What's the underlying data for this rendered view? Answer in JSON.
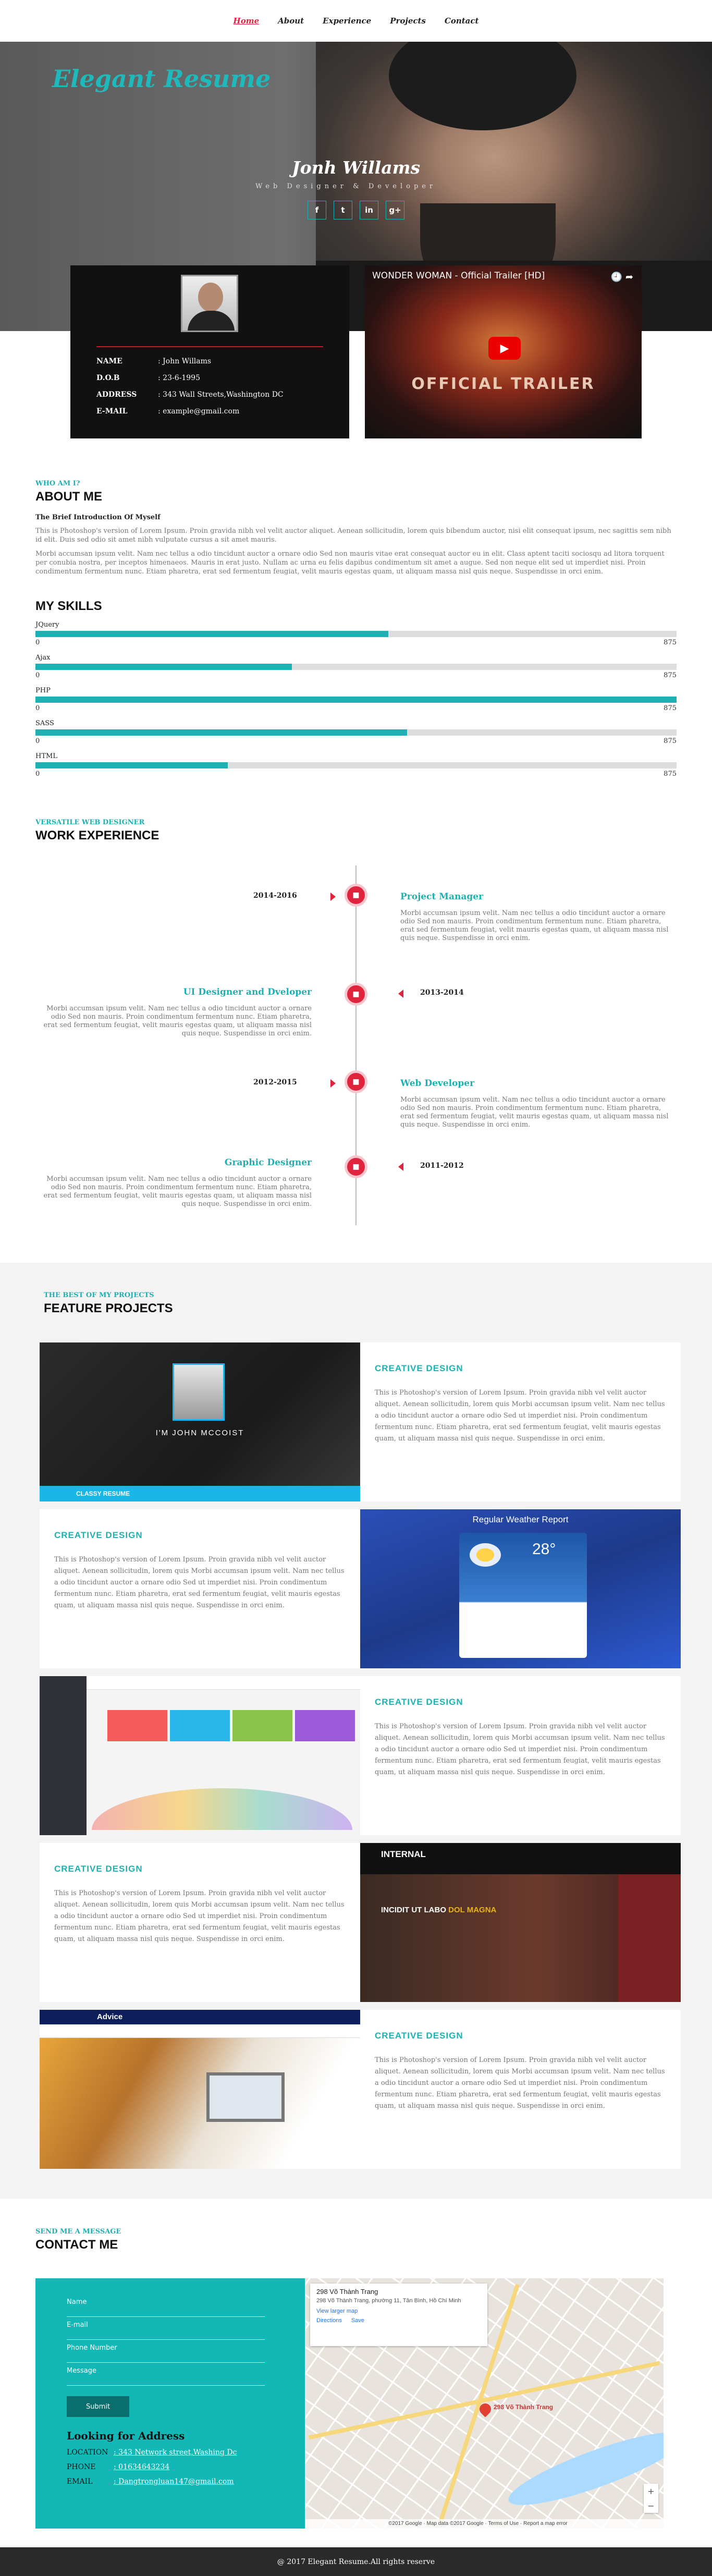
{
  "nav": [
    {
      "label": "Home",
      "active": true
    },
    {
      "label": "About",
      "active": false
    },
    {
      "label": "Experience",
      "active": false
    },
    {
      "label": "Projects",
      "active": false
    },
    {
      "label": "Contact",
      "active": false
    }
  ],
  "hero": {
    "brand": "Elegant Resume",
    "name": "Jonh Willams",
    "role": "Web Designer & Developer",
    "socials": [
      {
        "icon": "facebook-icon",
        "glyph": "f"
      },
      {
        "icon": "twitter-icon",
        "glyph": "t"
      },
      {
        "icon": "linkedin-icon",
        "glyph": "in"
      },
      {
        "icon": "google-plus-icon",
        "glyph": "g+"
      }
    ]
  },
  "profile": {
    "rows": [
      {
        "key": "NAME",
        "value": ": John Willams"
      },
      {
        "key": "D.O.B",
        "value": ": 23-6-1995"
      },
      {
        "key": "ADDRESS",
        "value": ": 343 Wall Streets,Washington DC"
      },
      {
        "key": "E-MAIL",
        "value": ": example@gmail.com"
      }
    ]
  },
  "video": {
    "title": "WONDER WOMAN - Official Trailer [HD]",
    "overlay": "OFFICIAL TRAILER"
  },
  "about": {
    "kicker": "WHO AM I?",
    "title": "ABOUT ME",
    "subtitle": "The Brief Introduction Of Myself",
    "paragraphs": [
      "This is Photoshop's version of Lorem Ipsum. Proin gravida nibh vel velit auctor aliquet. Aenean sollicitudin, lorem quis bibendum auctor, nisi elit consequat ipsum, nec sagittis sem nibh id elit. Duis sed odio sit amet nibh vulputate cursus a sit amet mauris.",
      "Morbi accumsan ipsum velit. Nam nec tellus a odio tincidunt auctor a ornare odio Sed non mauris vitae erat consequat auctor eu in elit. Class aptent taciti sociosqu ad litora torquent per conubia nostra, per inceptos himenaeos. Mauris in erat justo. Nullam ac urna eu felis dapibus condimentum sit amet a augue. Sed non neque elit sed ut imperdiet nisi. Proin condimentum fermentum nunc. Etiam pharetra, erat sed fermentum feugiat, velit mauris egestas quam, ut aliquam massa nisl quis neque. Suspendisse in orci enim."
    ]
  },
  "skills": {
    "title": "MY SKILLS",
    "scale_min": "0",
    "scale_max": "875",
    "items": [
      {
        "name": "JQuery",
        "level": 0.55
      },
      {
        "name": "Ajax",
        "level": 0.4
      },
      {
        "name": "PHP",
        "level": 1.0
      },
      {
        "name": "SASS",
        "level": 0.58
      },
      {
        "name": "HTML",
        "level": 0.3
      }
    ]
  },
  "work": {
    "kicker": "VERSATILE WEB DESIGNER",
    "title": "WORK EXPERIENCE",
    "items": [
      {
        "date": "2014-2016",
        "title": "Project Manager",
        "text": "Morbi accumsan ipsum velit. Nam nec tellus a odio tincidunt auctor a ornare odio Sed non mauris. Proin condimentum fermentum nunc. Etiam pharetra, erat sed fermentum feugiat, velit mauris egestas quam, ut aliquam massa nisl quis neque. Suspendisse in orci enim."
      },
      {
        "date": "2013-2014",
        "title": "UI Designer and Dveloper",
        "text": "Morbi accumsan ipsum velit. Nam nec tellus a odio tincidunt auctor a ornare odio Sed non mauris. Proin condimentum fermentum nunc. Etiam pharetra, erat sed fermentum feugiat, velit mauris egestas quam, ut aliquam massa nisl quis neque. Suspendisse in orci enim."
      },
      {
        "date": "2012-2015",
        "title": "Web Developer",
        "text": "Morbi accumsan ipsum velit. Nam nec tellus a odio tincidunt auctor a ornare odio Sed non mauris. Proin condimentum fermentum nunc. Etiam pharetra, erat sed fermentum feugiat, velit mauris egestas quam, ut aliquam massa nisl quis neque. Suspendisse in orci enim."
      },
      {
        "date": "2011-2012",
        "title": "Graphic Designer",
        "text": "Morbi accumsan ipsum velit. Nam nec tellus a odio tincidunt auctor a ornare odio Sed non mauris. Proin condimentum fermentum nunc. Etiam pharetra, erat sed fermentum feugiat, velit mauris egestas quam, ut aliquam massa nisl quis neque. Suspendisse in orci enim."
      }
    ]
  },
  "feature": {
    "kicker": "THE BEST OF MY PROJECTS",
    "title": "FEATURE PROJECTS",
    "heading": "CREATIVE DESIGN",
    "text": "This is Photoshop's version of Lorem Ipsum. Proin gravida nibh vel velit auctor aliquet. Aenean sollicitudin, lorem quis Morbi accumsan ipsum velit. Nam nec tellus a odio tincidunt auctor a ornare odio Sed ut imperdiet nisi. Proin condimentum fermentum nunc. Etiam pharetra, erat sed fermentum feugiat, velit mauris egestas quam, ut aliquam massa nisl quis neque. Suspendisse in orci enim.",
    "thumb1_name": "I'M JOHN MCCOIST",
    "thumb1_tag": "CLASSY RESUME",
    "thumb2_title": "Regular Weather Report",
    "thumb2_temp": "28°",
    "thumb4_logo": "INTERNAL",
    "thumb4_headline_a": "INCIDIT UT LABO",
    "thumb4_headline_b": "DOL MAGNA",
    "thumb5_logo": "Advice"
  },
  "contact": {
    "kicker": "SEND ME A MESSAGE",
    "title": "CONTACT ME",
    "fields": [
      "Name",
      "E-mail",
      "Phone Number",
      "Message"
    ],
    "submit": "Submit",
    "address_title": "Looking for Address",
    "address": [
      {
        "key": "LOCATION",
        "value": ": 343 Network street,Washing Dc"
      },
      {
        "key": "PHONE",
        "value": ": 01634643234"
      },
      {
        "key": "EMAIL",
        "value": ": Dangtrongluan147@gmail.com"
      }
    ],
    "map": {
      "place": "298 Võ Thành Trang",
      "place_address": "298 Võ Thành Trang, phường 11, Tân Bình, Hồ Chí Minh",
      "view_larger": "View larger map",
      "directions": "Directions",
      "save": "Save",
      "pin_label": "298 Võ Thành Trang",
      "credit": "©2017 Google · Map data ©2017 Google · Terms of Use · Report a map error"
    }
  },
  "footer": "@ 2017 Elegant Resume.All rights reserve"
}
